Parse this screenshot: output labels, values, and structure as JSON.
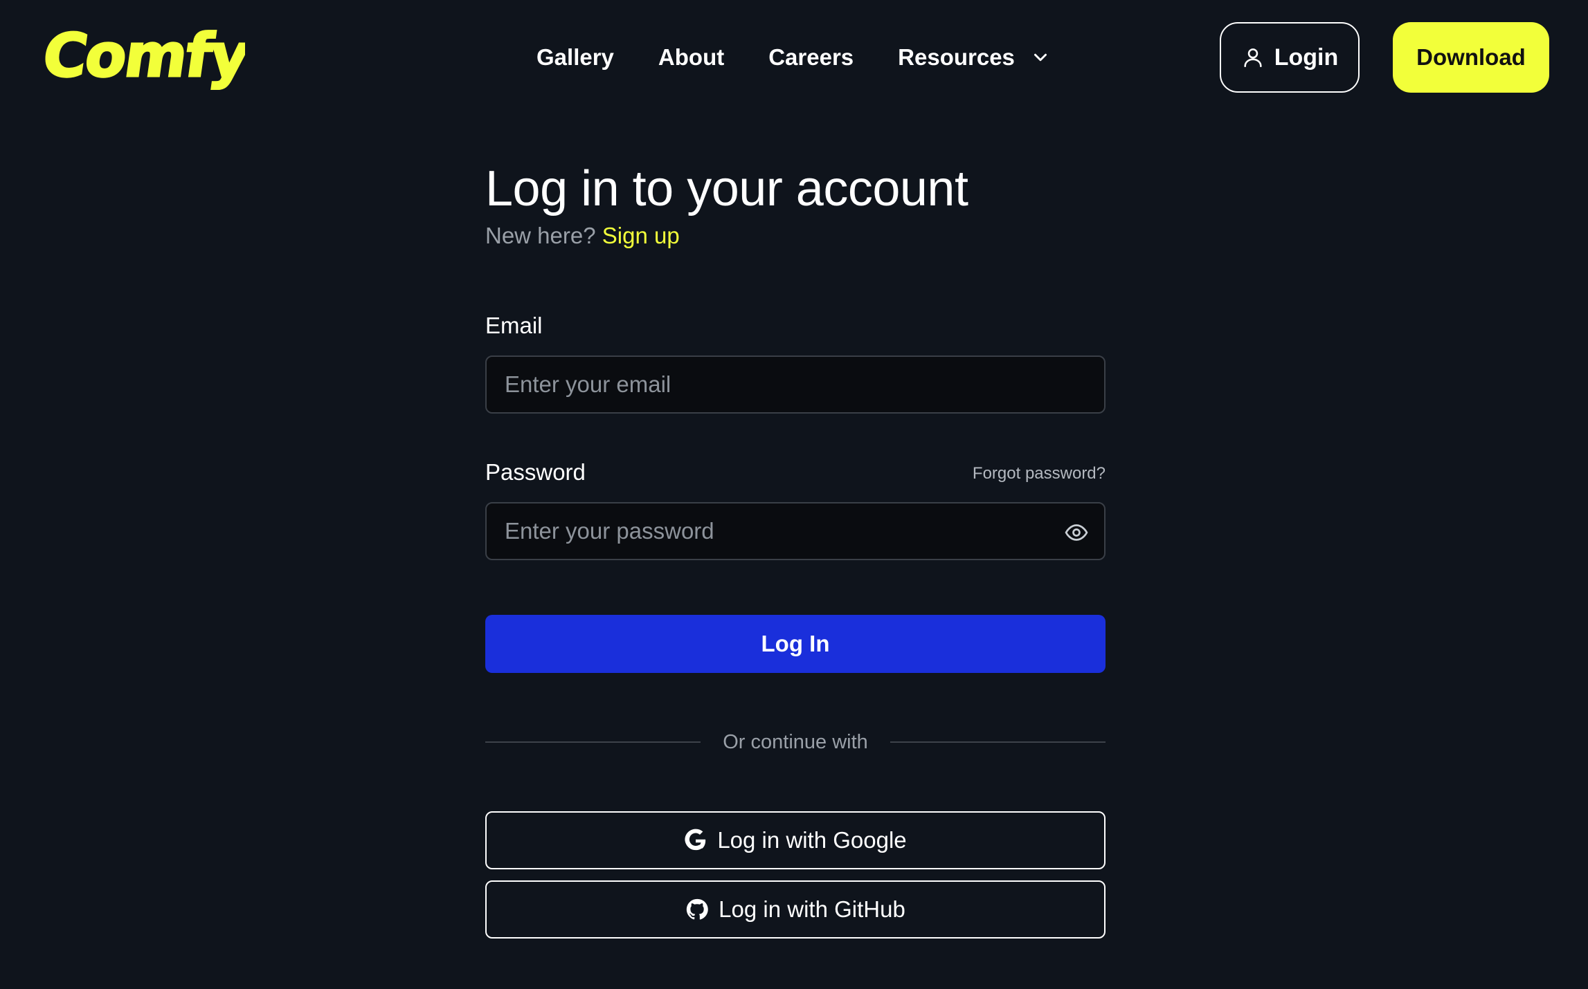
{
  "brand": {
    "logo_text": "Comfy",
    "accent_color": "#f2ff3a",
    "background_color": "#0f141c",
    "primary_color": "#1a2fdb"
  },
  "nav": {
    "items": [
      {
        "label": "Gallery"
      },
      {
        "label": "About"
      },
      {
        "label": "Careers"
      },
      {
        "label": "Resources"
      }
    ],
    "resources_icon": "chevron-down-icon"
  },
  "header": {
    "login_label": "Login",
    "login_icon": "user-icon",
    "download_label": "Download"
  },
  "login_form": {
    "title": "Log in to your account",
    "subtitle_prefix": "New here?",
    "signup_link": "Sign up",
    "email": {
      "label": "Email",
      "placeholder": "Enter your email",
      "value": ""
    },
    "password": {
      "label": "Password",
      "placeholder": "Enter your password",
      "value": "",
      "forgot_link": "Forgot password?",
      "toggle_icon": "eye-icon"
    },
    "submit_label": "Log In",
    "divider_text": "Or continue with",
    "oauth": [
      {
        "label": "Log in with Google",
        "icon": "google-icon"
      },
      {
        "label": "Log in with GitHub",
        "icon": "github-icon"
      }
    ]
  }
}
